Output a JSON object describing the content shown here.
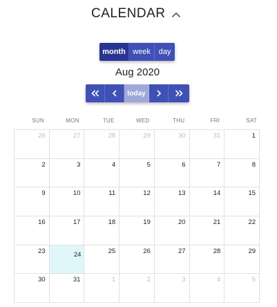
{
  "header": {
    "title": "CALENDAR",
    "toggle_icon": "chevron-up-icon"
  },
  "views": {
    "month": "month",
    "week": "week",
    "day": "day",
    "active": "month"
  },
  "month_label": "Aug 2020",
  "nav": {
    "prev_year": "«",
    "prev": "‹",
    "today": "today",
    "next": "›",
    "next_year": "»"
  },
  "colors": {
    "primary": "#3f51b5",
    "primary_active": "#283593",
    "today_btn": "#9fa8da",
    "today_cell": "#e0f7fa"
  },
  "weekdays": [
    "SUN",
    "MON",
    "TUE",
    "WED",
    "THU",
    "FRI",
    "SAT"
  ],
  "weeks": [
    [
      {
        "d": "26",
        "o": true
      },
      {
        "d": "27",
        "o": true
      },
      {
        "d": "28",
        "o": true
      },
      {
        "d": "29",
        "o": true
      },
      {
        "d": "30",
        "o": true
      },
      {
        "d": "31",
        "o": true
      },
      {
        "d": "1",
        "o": false
      }
    ],
    [
      {
        "d": "2",
        "o": false
      },
      {
        "d": "3",
        "o": false
      },
      {
        "d": "4",
        "o": false
      },
      {
        "d": "5",
        "o": false
      },
      {
        "d": "6",
        "o": false
      },
      {
        "d": "7",
        "o": false
      },
      {
        "d": "8",
        "o": false
      }
    ],
    [
      {
        "d": "9",
        "o": false
      },
      {
        "d": "10",
        "o": false
      },
      {
        "d": "11",
        "o": false
      },
      {
        "d": "12",
        "o": false
      },
      {
        "d": "13",
        "o": false
      },
      {
        "d": "14",
        "o": false
      },
      {
        "d": "15",
        "o": false
      }
    ],
    [
      {
        "d": "16",
        "o": false
      },
      {
        "d": "17",
        "o": false
      },
      {
        "d": "18",
        "o": false
      },
      {
        "d": "19",
        "o": false
      },
      {
        "d": "20",
        "o": false
      },
      {
        "d": "21",
        "o": false
      },
      {
        "d": "22",
        "o": false
      }
    ],
    [
      {
        "d": "23",
        "o": false
      },
      {
        "d": "24",
        "o": false,
        "today": true
      },
      {
        "d": "25",
        "o": false
      },
      {
        "d": "26",
        "o": false
      },
      {
        "d": "27",
        "o": false
      },
      {
        "d": "28",
        "o": false
      },
      {
        "d": "29",
        "o": false
      }
    ],
    [
      {
        "d": "30",
        "o": false
      },
      {
        "d": "31",
        "o": false
      },
      {
        "d": "1",
        "o": true
      },
      {
        "d": "2",
        "o": true
      },
      {
        "d": "3",
        "o": true
      },
      {
        "d": "4",
        "o": true
      },
      {
        "d": "5",
        "o": true
      }
    ]
  ]
}
